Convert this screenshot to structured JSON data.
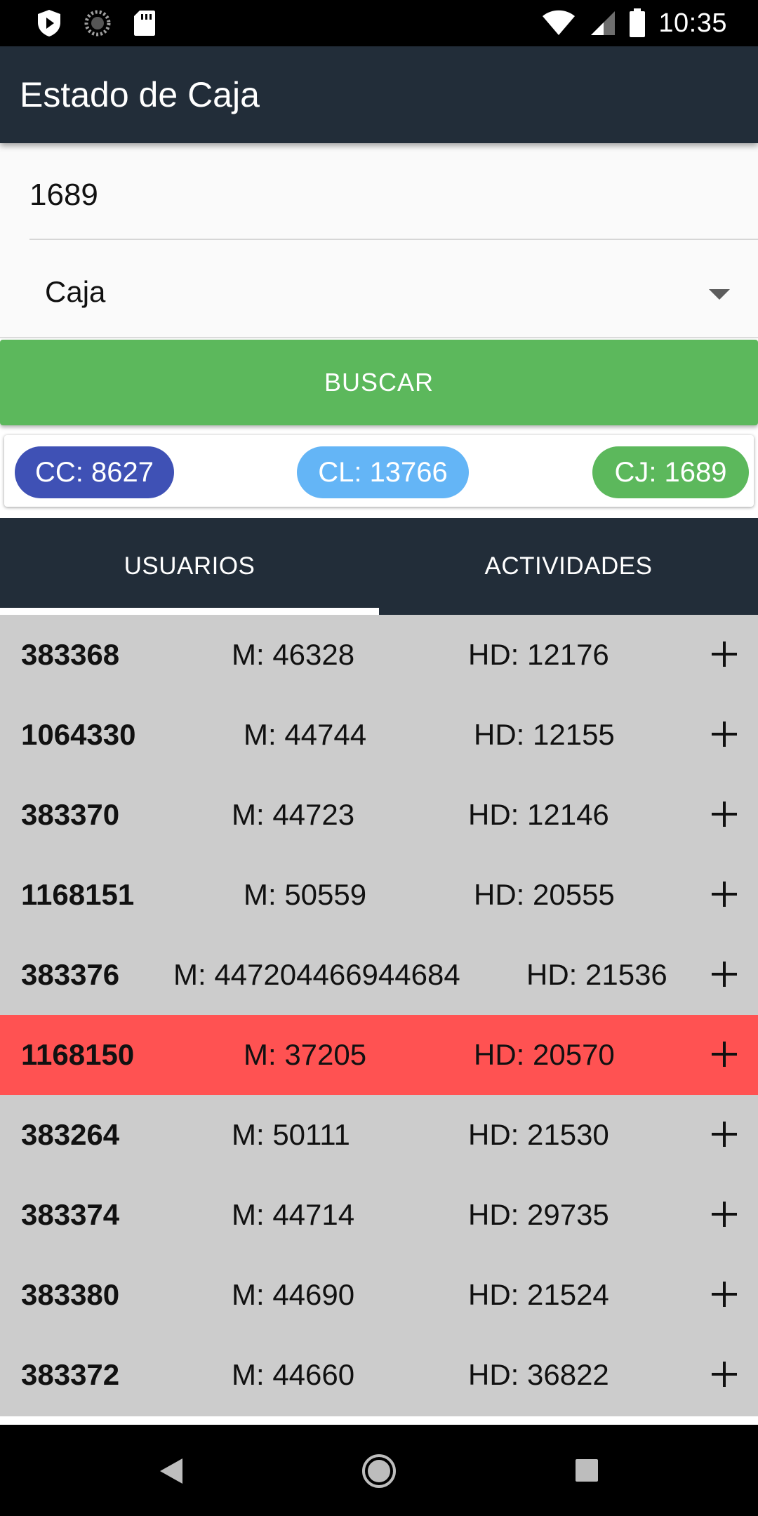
{
  "status_bar": {
    "time": "10:35",
    "left_icons": [
      "shield-play-icon",
      "loading-circle-icon",
      "sd-card-icon"
    ],
    "right_icons": [
      "wifi-icon",
      "cell-signal-icon",
      "battery-icon"
    ]
  },
  "app_bar": {
    "title": "Estado de Caja"
  },
  "form": {
    "code_value": "1689",
    "select_value": "Caja",
    "search_label": "BUSCAR"
  },
  "chips": {
    "cc": "CC: 8627",
    "cl": "CL: 13766",
    "cj": "CJ: 1689",
    "colors": {
      "cc": "#3f51b5",
      "cl": "#64b5f6",
      "cj": "#5cb85c"
    }
  },
  "tabs": {
    "usuarios": "USUARIOS",
    "actividades": "ACTIVIDADES",
    "selected": "USUARIOS"
  },
  "users": [
    {
      "id": "383368",
      "m": "M: 46328",
      "hd": "HD: 12176",
      "highlight": false
    },
    {
      "id": "1064330",
      "m": "M: 44744",
      "hd": "HD: 12155",
      "highlight": false
    },
    {
      "id": "383370",
      "m": "M: 44723",
      "hd": "HD: 12146",
      "highlight": false
    },
    {
      "id": "1168151",
      "m": "M: 50559",
      "hd": "HD: 20555",
      "highlight": false
    },
    {
      "id": "383376",
      "m": "M: 447204466944684",
      "hd": "HD: 21536",
      "highlight": false
    },
    {
      "id": "1168150",
      "m": "M: 37205",
      "hd": "HD: 20570",
      "highlight": true
    },
    {
      "id": "383264",
      "m": "M: 50111",
      "hd": "HD: 21530",
      "highlight": false
    },
    {
      "id": "383374",
      "m": "M: 44714",
      "hd": "HD: 29735",
      "highlight": false
    },
    {
      "id": "383380",
      "m": "M: 44690",
      "hd": "HD: 21524",
      "highlight": false
    },
    {
      "id": "383372",
      "m": "M: 44660",
      "hd": "HD: 36822",
      "highlight": false
    }
  ],
  "colors": {
    "app_bar": "#222d39",
    "button": "#5cb85c",
    "list_bg": "#cccccc",
    "highlight_row": "#ff5252"
  }
}
